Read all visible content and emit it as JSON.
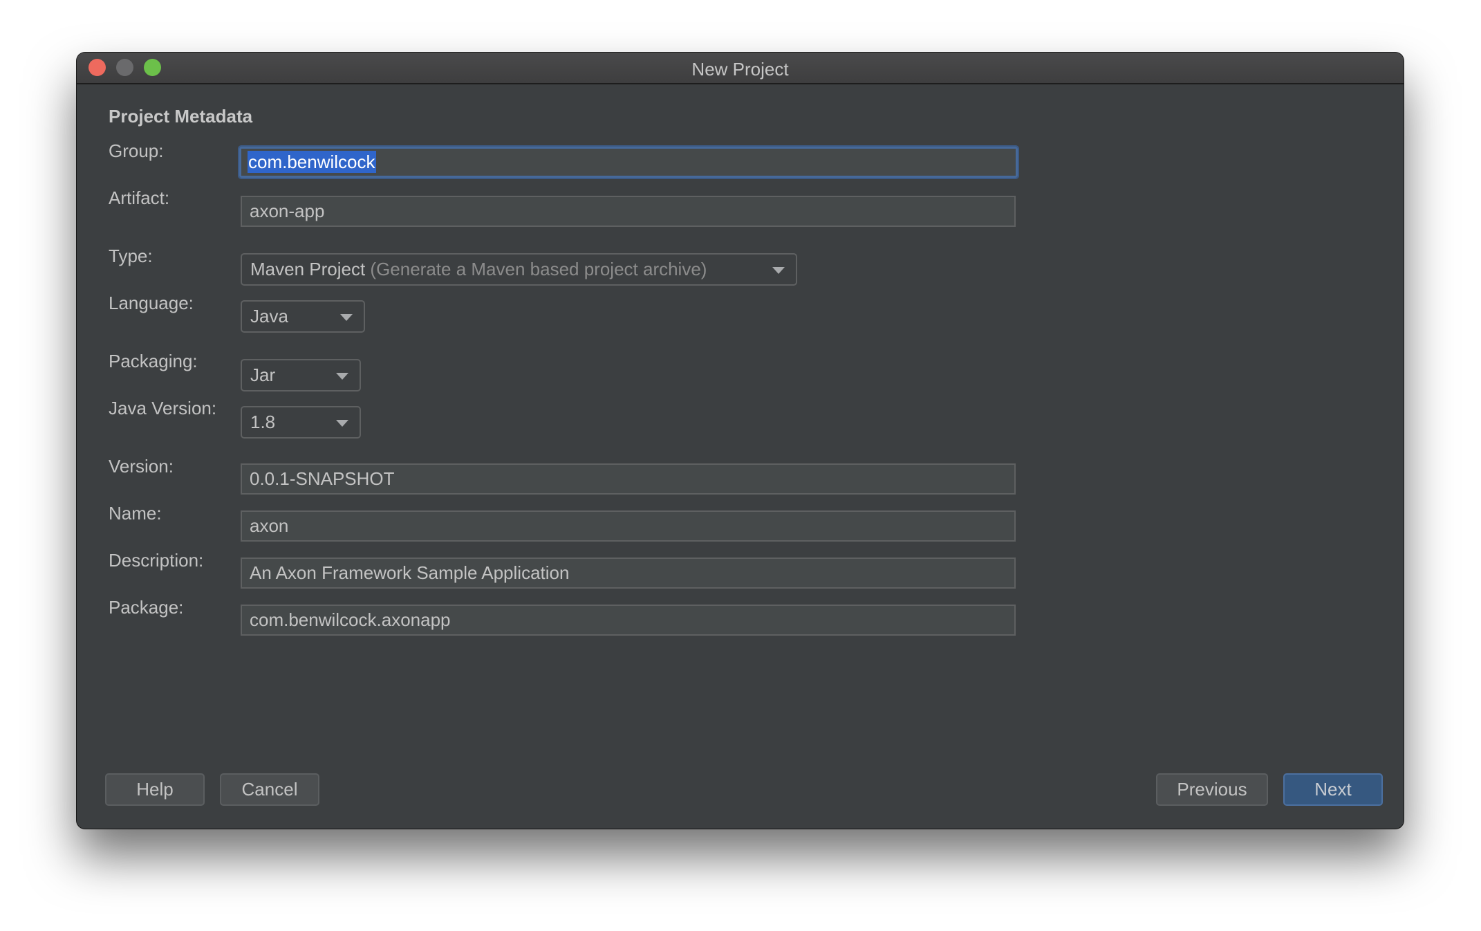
{
  "window": {
    "title": "New Project",
    "traffic_lights": [
      "close",
      "minimize",
      "maximize"
    ]
  },
  "section_title": "Project Metadata",
  "fields": {
    "group": {
      "label": "Group:",
      "value": "com.benwilcock"
    },
    "artifact": {
      "label": "Artifact:",
      "value": "axon-app"
    },
    "type": {
      "label": "Type:",
      "value": "Maven Project",
      "hint": "(Generate a Maven based project archive)"
    },
    "language": {
      "label": "Language:",
      "value": "Java"
    },
    "packaging": {
      "label": "Packaging:",
      "value": "Jar"
    },
    "java_version": {
      "label": "Java Version:",
      "value": "1.8"
    },
    "version": {
      "label": "Version:",
      "value": "0.0.1-SNAPSHOT"
    },
    "name": {
      "label": "Name:",
      "value": "axon"
    },
    "description": {
      "label": "Description:",
      "value": "An Axon Framework Sample Application"
    },
    "package": {
      "label": "Package:",
      "value": "com.benwilcock.axonapp"
    }
  },
  "buttons": {
    "help": "Help",
    "cancel": "Cancel",
    "previous": "Previous",
    "next": "Next"
  },
  "colors": {
    "accent": "#365880",
    "focus_ring": "#46699a",
    "selection": "#2f65ca",
    "background": "#3c3f41"
  }
}
